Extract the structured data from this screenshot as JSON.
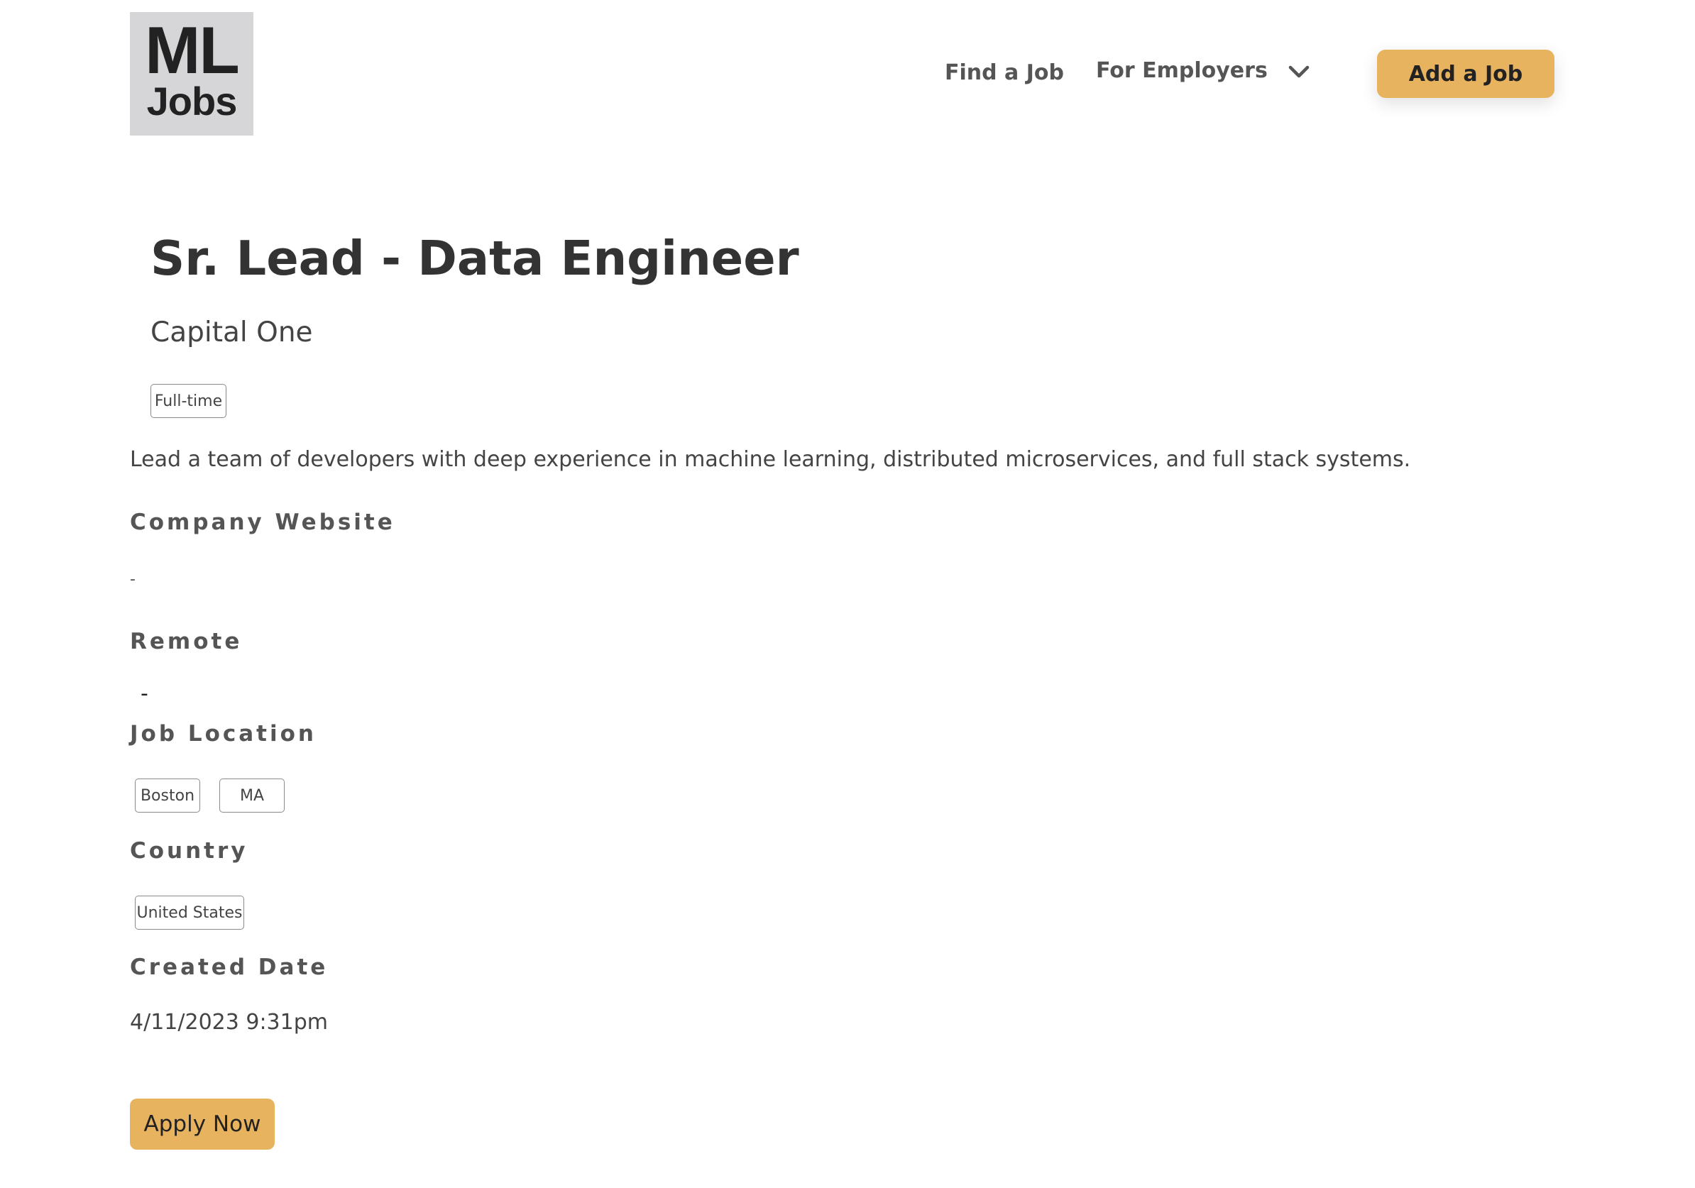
{
  "header": {
    "logo": {
      "line1": "ML",
      "line2": "Jobs"
    },
    "nav": {
      "find_job": "Find a Job",
      "for_employers": "For Employers"
    },
    "add_job_label": "Add a Job"
  },
  "icons": {
    "employers_dropdown": "chevron-down-icon"
  },
  "colors": {
    "accent": "#e8b35f",
    "logo_bg": "#d6d6d8"
  },
  "job": {
    "title": "Sr. Lead - Data Engineer",
    "company": "Capital One",
    "employment_type": "Full-time",
    "description": "Lead a team of developers with deep experience in machine learning, distributed microservices, and full stack systems.",
    "company_website": {
      "label": "Company Website",
      "value": "-"
    },
    "remote": {
      "label": "Remote",
      "value": "-"
    },
    "job_location": {
      "label": "Job Location",
      "city": "Boston",
      "state": "MA"
    },
    "country": {
      "label": "Country",
      "value": "United States"
    },
    "created_date": {
      "label": "Created Date",
      "value": "4/11/2023 9:31pm"
    },
    "apply_label": "Apply Now"
  }
}
